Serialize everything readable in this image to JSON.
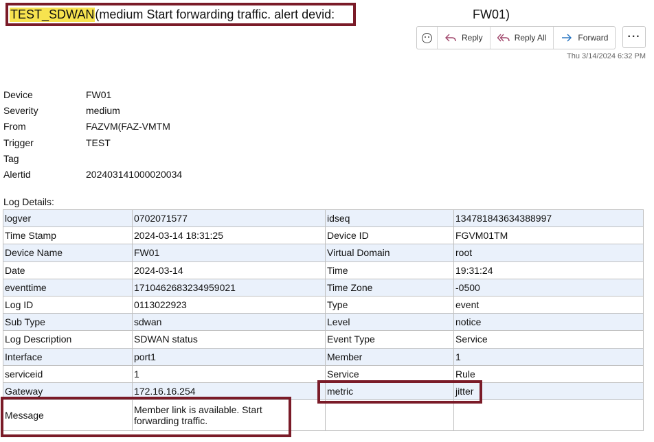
{
  "email": {
    "subject_highlight": "TEST_SDWAN",
    "subject_rest": " (medium Start forwarding traffic. alert devid:",
    "subject_tail": "FW01)",
    "datetime": "Thu 3/14/2024 6:32 PM"
  },
  "toolbar": {
    "emoji_icon": "smiley-icon",
    "reply_label": "Reply",
    "reply_all_label": "Reply All",
    "forward_label": "Forward",
    "more_label": "···"
  },
  "fields": [
    {
      "label": "Device",
      "value": "FW01"
    },
    {
      "label": "Severity",
      "value": "medium"
    },
    {
      "label": "From",
      "value": "FAZVM(FAZ-VMTM"
    },
    {
      "label": "Trigger",
      "value": "TEST"
    },
    {
      "label": "Tag",
      "value": ""
    },
    {
      "label": "Alertid",
      "value": "202403141000020034"
    }
  ],
  "log_title": "Log Details:",
  "log_rows": [
    [
      "logver",
      "0702071577",
      "idseq",
      "134781843634388997"
    ],
    [
      "Time Stamp",
      "2024-03-14 18:31:25",
      "Device ID",
      "FGVM01TM"
    ],
    [
      "Device Name",
      "FW01",
      "Virtual Domain",
      "root"
    ],
    [
      "Date",
      "2024-03-14",
      "Time",
      "19:31:24"
    ],
    [
      "eventtime",
      "1710462683234959021",
      "Time Zone",
      "-0500"
    ],
    [
      "Log ID",
      "0113022923",
      "Type",
      "event"
    ],
    [
      "Sub Type",
      "sdwan",
      "Level",
      "notice"
    ],
    [
      "Log Description",
      "SDWAN status",
      "Event Type",
      "Service"
    ],
    [
      "Interface",
      "port1",
      "Member",
      "1"
    ],
    [
      "serviceid",
      "1",
      "Service",
      "Rule"
    ],
    [
      "Gateway",
      "172.16.16.254",
      "metric",
      "jitter"
    ]
  ],
  "message_row": {
    "label": "Message",
    "value_line1": "Member link is available. Start",
    "value_line2": "forwarding traffic."
  },
  "colors": {
    "highlight": "#f7e34f",
    "annotation_border": "#7a1b28",
    "row_alt": "#eaf1fb",
    "accent_blue": "#1f6fbf"
  }
}
